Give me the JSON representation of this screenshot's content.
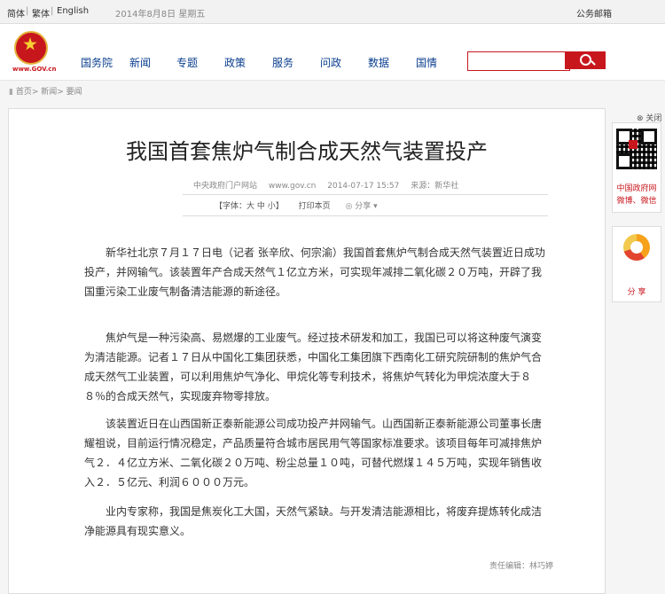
{
  "topbar": {
    "lang_simplified": "简体",
    "lang_traditional": "繁体",
    "lang_english": "English",
    "date": "2014年8月8日 星期五",
    "mail": "公务邮箱"
  },
  "logo": {
    "text": "www.GOV.cn"
  },
  "nav": [
    "国务院",
    "新闻",
    "专题",
    "政策",
    "服务",
    "问政",
    "数据",
    "国情"
  ],
  "search": {
    "value": "",
    "placeholder": ""
  },
  "breadcrumb": "首页> 新闻> 要闻",
  "article": {
    "title": "我国首套焦炉气制合成天然气装置投产",
    "source_site": "中央政府门户网站",
    "site_url": "www.gov.cn",
    "datetime": "2014-07-17 15:57",
    "origin": "来源：新华社",
    "font_size_label": "【字体：大 中 小】",
    "print_label": "打印本页",
    "share_label": "分享",
    "paragraphs": [
      "新华社北京７月１７日电（记者 张辛欣、何宗渝）我国首套焦炉气制合成天然气装置近日成功投产，并网输气。该装置年产合成天然气１亿立方米，可实现年减排二氧化碳２０万吨，开辟了我国重污染工业废气制备清洁能源的新途径。",
      "焦炉气是一种污染高、易燃爆的工业废气。经过技术研发和加工，我国已可以将这种废气演变为清洁能源。记者１７日从中国化工集团获悉，中国化工集团旗下西南化工研究院研制的焦炉气合成天然气工业装置，可以利用焦炉气净化、甲烷化等专利技术，将焦炉气转化为甲烷浓度大于８８％的合成天然气，实现废弃物零排放。",
      "该装置近日在山西国新正泰新能源公司成功投产并网输气。山西国新正泰新能源公司董事长唐耀祖说，目前运行情况稳定，产品质量符合城市居民用气等国家标准要求。该项目每年可减排焦炉气２．４亿立方米、二氧化碳２０万吨、粉尘总量１０吨，可替代燃煤１４５万吨，实现年销售收入２．５亿元、利润６０００万元。",
      "业内专家称，我国是焦炭化工大国，天然气紧缺。与开发清洁能源相比，将废弃提炼转化成洁净能源具有现实意义。"
    ],
    "editor": "责任编辑：林巧婷"
  },
  "sidebar": {
    "close_label": "关闭",
    "qr_label1": "中国政府网",
    "qr_label2": "微博、微信",
    "share_label": "分 享"
  },
  "colors": {
    "brand_red": "#c8161d",
    "nav_blue": "#0b3f8f"
  }
}
